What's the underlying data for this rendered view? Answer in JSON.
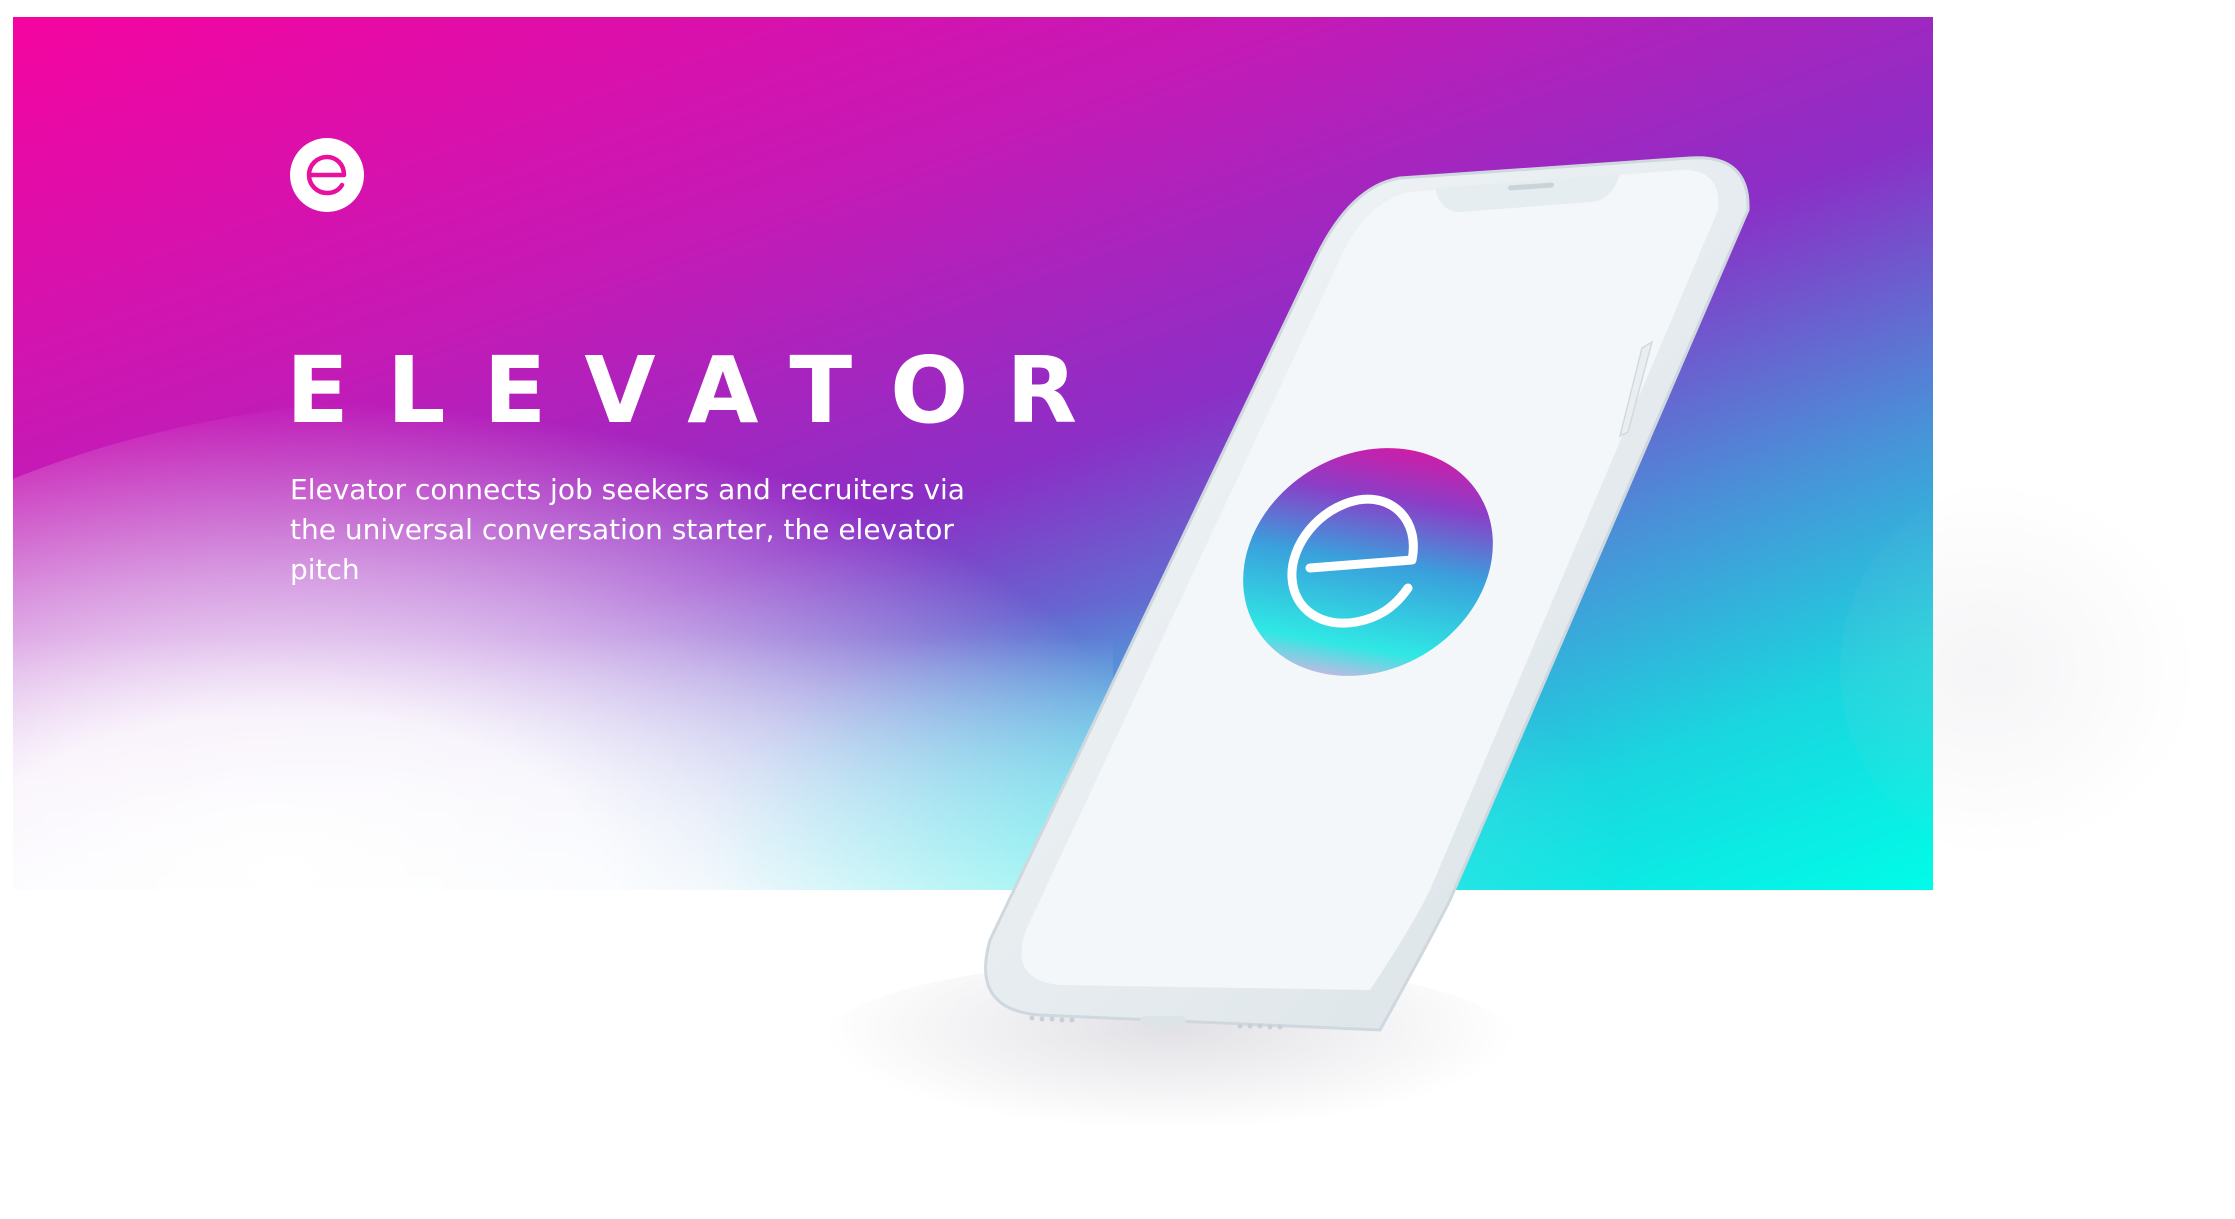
{
  "brand": {
    "logo_icon": "elevator-e-logo-icon",
    "name": "ELEVATOR",
    "tagline": "Elevator connects job seekers and recruiters via the universal conversation starter, the elevator pitch"
  },
  "phone": {
    "app_icon": "elevator-e-app-icon"
  },
  "colors": {
    "gradient_magenta": "#f5049f",
    "gradient_purple": "#8b2fc6",
    "gradient_cyan": "#00fce8",
    "text": "#ffffff",
    "phone_body": "#e7edf1"
  }
}
